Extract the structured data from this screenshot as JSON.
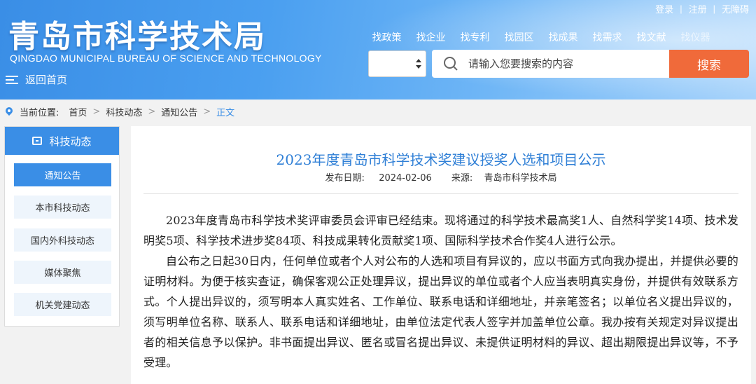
{
  "header": {
    "logo_cn": "青岛市科学技术局",
    "logo_en": "QINGDAO MUNICIPAL BUREAU OF SCIENCE AND TECHNOLOGY",
    "home_label": "返回首页",
    "top_links": {
      "login": "登录",
      "register": "注册",
      "accessibility": "无障碍"
    },
    "nav": [
      "找政策",
      "找企业",
      "找专利",
      "找园区",
      "找成果",
      "找需求",
      "找文献",
      "找仪器"
    ],
    "search": {
      "placeholder": "请输入您要搜索的内容",
      "button": "搜索"
    }
  },
  "breadcrumb": {
    "prefix": "当前位置:",
    "items": [
      "首页",
      "科技动态",
      "通知公告",
      "正文"
    ]
  },
  "sidebar": {
    "title": "科技动态",
    "items": [
      "通知公告",
      "本市科技动态",
      "国内外科技动态",
      "媒体聚焦",
      "机关党建动态"
    ],
    "active_index": 0
  },
  "article": {
    "title": "2023年度青岛市科学技术奖建议授奖人选和项目公示",
    "date_label": "发布日期:",
    "date": "2024-02-06",
    "source_label": "来源:",
    "source": "青岛市科学技术局",
    "paragraphs": [
      "2023年度青岛市科学技术奖评审委员会评审已经结束。现将通过的科学技术最高奖1人、自然科学奖14项、技术发明奖5项、科学技术进步奖84项、科技成果转化贡献奖1项、国际科学技术合作奖4人进行公示。",
      "自公布之日起30日内，任何单位或者个人对公布的人选和项目有异议的，应以书面方式向我办提出，并提供必要的证明材料。为便于核实查证，确保客观公正处理异议，提出异议的单位或者个人应当表明真实身份，并提供有效联系方式。个人提出异议的，须写明本人真实姓名、工作单位、联系电话和详细地址，并亲笔签名；以单位名义提出异议的，须写明单位名称、联系人、联系电话和详细地址，由单位法定代表人签字并加盖单位公章。我办按有关规定对异议提出者的相关信息予以保护。非书面提出异议、匿名或冒名提出异议、未提供证明材料的异议、超出期限提出异议等，不予受理。"
    ]
  },
  "colors": {
    "brand_blue": "#3a8ee6",
    "search_orange": "#f06a3a",
    "title_blue": "#2f7fd6"
  }
}
